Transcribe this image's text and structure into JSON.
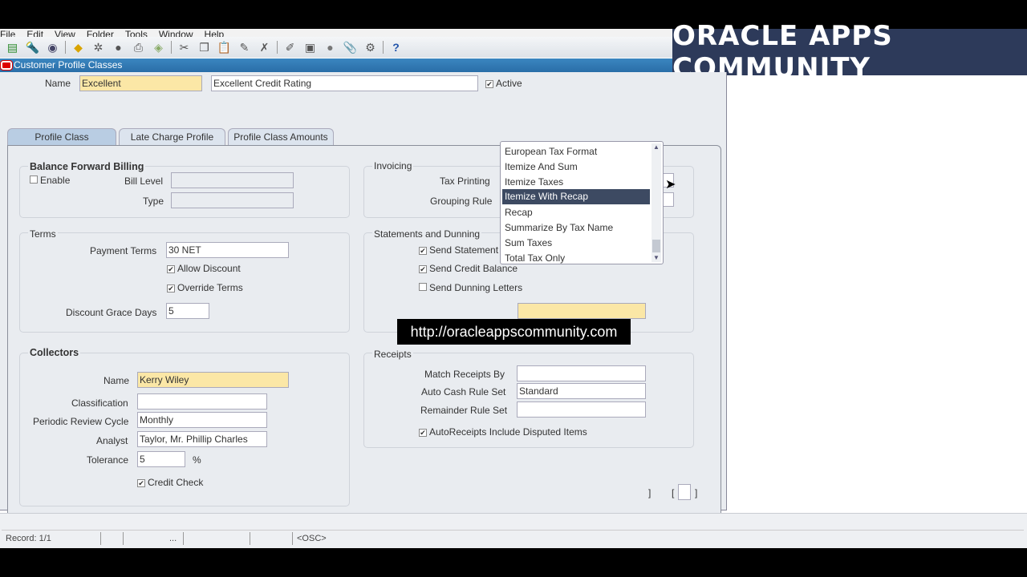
{
  "menu": [
    "File",
    "Edit",
    "View",
    "Folder",
    "Tools",
    "Window",
    "Help"
  ],
  "toolbar_icons": [
    "new-icon",
    "find-icon",
    "navigator-icon",
    "save-icon",
    "next-step-icon",
    "switch-responsibility-icon",
    "print-icon",
    "close-form-icon",
    "cut-icon",
    "copy-icon",
    "paste-icon",
    "clear-record-icon",
    "delete-record-icon",
    "edit-field-icon",
    "zoom-icon",
    "translations-icon",
    "attachments-icon",
    "folder-tools-icon",
    "help-icon"
  ],
  "banner": "ORACLE APPS COMMUNITY",
  "window_title": "Customer Profile Classes",
  "header": {
    "name_label": "Name",
    "name_value": "Excellent",
    "description": "Excellent Credit Rating",
    "active_label": "Active",
    "active_checked": true
  },
  "tabs": [
    "Profile Class",
    "Late Charge Profile",
    "Profile Class Amounts"
  ],
  "bfb": {
    "title": "Balance Forward Billing",
    "enable": "Enable",
    "bill_level": "Bill Level",
    "type": "Type"
  },
  "terms": {
    "title": "Terms",
    "payment_terms_label": "Payment Terms",
    "payment_terms": "30 NET",
    "allow_discount": "Allow Discount",
    "override_terms": "Override Terms",
    "grace_label": "Discount Grace Days",
    "grace": "5"
  },
  "collectors": {
    "title": "Collectors",
    "name_label": "Name",
    "name": "Kerry Wiley",
    "classification_label": "Classification",
    "classification": "",
    "review_label": "Periodic Review Cycle",
    "review": "Monthly",
    "analyst_label": "Analyst",
    "analyst": "Taylor, Mr. Phillip Charles",
    "tolerance_label": "Tolerance",
    "tolerance": "5",
    "percent": "%",
    "credit_check": "Credit Check"
  },
  "invoicing": {
    "title": "Invoicing",
    "tax_printing": "Tax Printing",
    "grouping_rule": "Grouping Rule"
  },
  "statements": {
    "title": "Statements and Dunning",
    "send_statement": "Send Statement",
    "send_credit_balance": "Send Credit Balance",
    "send_dunning": "Send Dunning Letters"
  },
  "receipts": {
    "title": "Receipts",
    "match_label": "Match Receipts By",
    "match": "",
    "auto_cash_label": "Auto Cash Rule Set",
    "auto_cash": "Standard",
    "remainder_label": "Remainder Rule Set",
    "remainder": "",
    "autoreceipts": "AutoReceipts Include Disputed Items"
  },
  "dropdown": {
    "options": [
      "European Tax Format",
      "Itemize And Sum",
      "Itemize Taxes",
      "Itemize With Recap",
      "Recap",
      "Summarize By Tax Name",
      "Sum Taxes",
      "Total Tax Only"
    ],
    "selected": "Itemize With Recap"
  },
  "url_overlay": "http://oracleappscommunity.com",
  "status": {
    "record": "Record: 1/1",
    "ellipsis": "...",
    "osc": "<OSC>"
  }
}
